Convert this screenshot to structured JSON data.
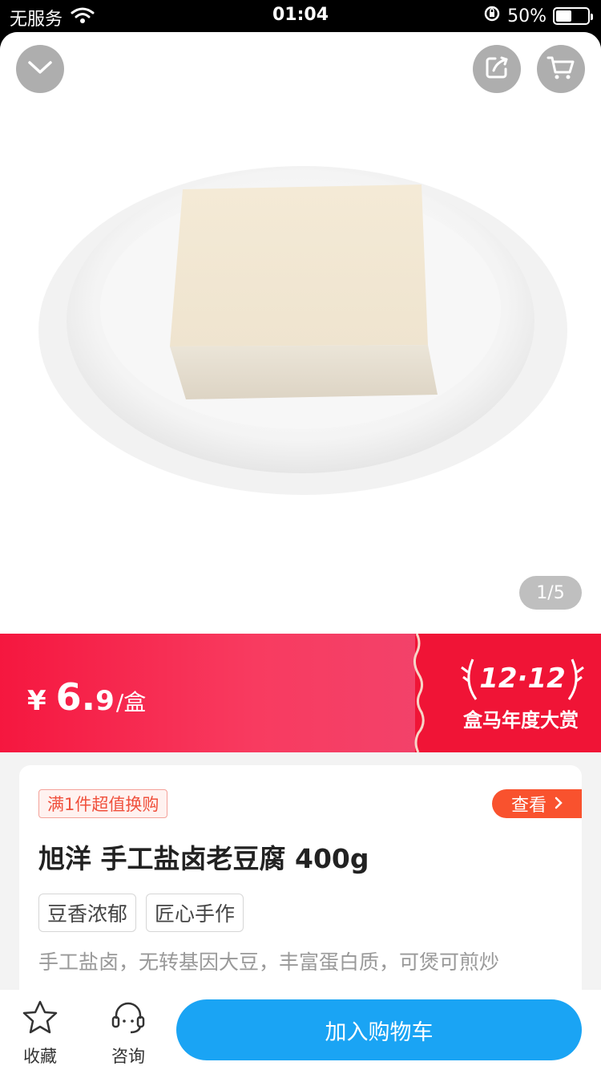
{
  "status_bar": {
    "carrier": "无服务",
    "time": "01:04",
    "battery_percent": "50%",
    "battery_level": 0.5,
    "icons": [
      "wifi-icon",
      "orientation-lock-icon",
      "battery-icon"
    ]
  },
  "header": {
    "icons": [
      "chevron-down-icon",
      "share-icon",
      "cart-icon"
    ]
  },
  "gallery": {
    "counter": "1/5"
  },
  "promo": {
    "currency": "¥",
    "price_int": "6.",
    "price_dec": "9",
    "unit": "/盒",
    "badge": "12·12",
    "event": "盒马年度大赏",
    "colors": {
      "band": "#f5173f",
      "badge_bg": "#f01436"
    }
  },
  "product": {
    "deal_tag": "满1件超值换购",
    "view_label": "查看",
    "title": "旭洋 手工盐卤老豆腐 400g",
    "chips": [
      "豆香浓郁",
      "匠心手作"
    ],
    "description": "手工盐卤，无转基因大豆，丰富蛋白质，可煲可煎炒"
  },
  "bottom_bar": {
    "favorite_label": "收藏",
    "consult_label": "咨询",
    "add_to_cart_label": "加入购物车",
    "colors": {
      "cart_button": "#1aa4f4"
    }
  }
}
